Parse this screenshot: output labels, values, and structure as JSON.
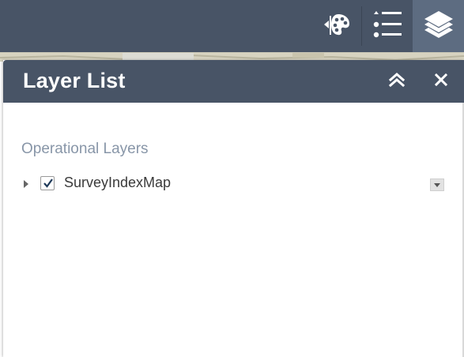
{
  "toolbar": {
    "buttons": [
      {
        "id": "symbology",
        "icon": "palette-icon"
      },
      {
        "id": "legend",
        "icon": "list-icon"
      },
      {
        "id": "layers",
        "icon": "layers-icon",
        "active": true
      }
    ]
  },
  "panel": {
    "title": "Layer List",
    "collapse_icon": "double-chevron-up-icon",
    "close_icon": "close-icon",
    "section_heading": "Operational Layers",
    "layers": [
      {
        "label": "SurveyIndexMap",
        "checked": true,
        "expanded": false
      }
    ]
  },
  "colors": {
    "header_bg": "#485466",
    "active_tab_bg": "#5d6c81",
    "heading_text": "#8896a8",
    "label_text": "#3a3a3a"
  }
}
